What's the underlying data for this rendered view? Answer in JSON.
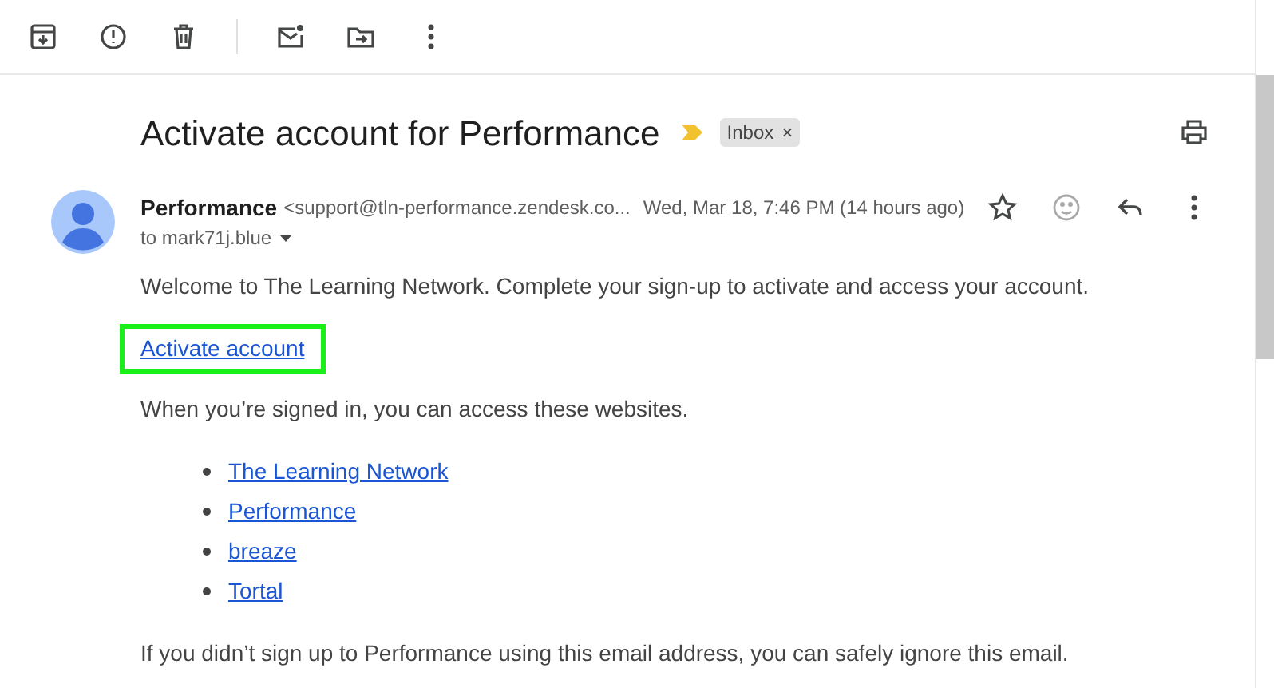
{
  "toolbar": {
    "buttons": [
      {
        "kind": "archive"
      },
      {
        "kind": "spam"
      },
      {
        "kind": "delete"
      },
      {
        "kind": "divider"
      },
      {
        "kind": "unread"
      },
      {
        "kind": "move"
      },
      {
        "kind": "more"
      }
    ]
  },
  "subject": {
    "title": "Activate account for Performance",
    "important": true,
    "labels": [
      {
        "text": "Inbox",
        "close": "×"
      }
    ]
  },
  "message": {
    "sender": "Performance",
    "email": "<support@tln-performance.zendesk.co...",
    "time": "Wed, Mar 18, 7:46 PM (14 hours ago)",
    "starred": false,
    "recipient": "to mark71j.blue"
  },
  "body": {
    "intro": "Welcome to The Learning Network. Complete your sign-up to activate and access your account.",
    "action_link": {
      "text": "Activate account",
      "highlighted": true
    },
    "websites_intro": "When you’re signed in, you can access these websites.",
    "websites": [
      "The Learning Network",
      "Performance",
      "breaze",
      "Tortal"
    ],
    "footer": "If you didn’t sign up to Performance using this email address, you can safely ignore this email."
  }
}
